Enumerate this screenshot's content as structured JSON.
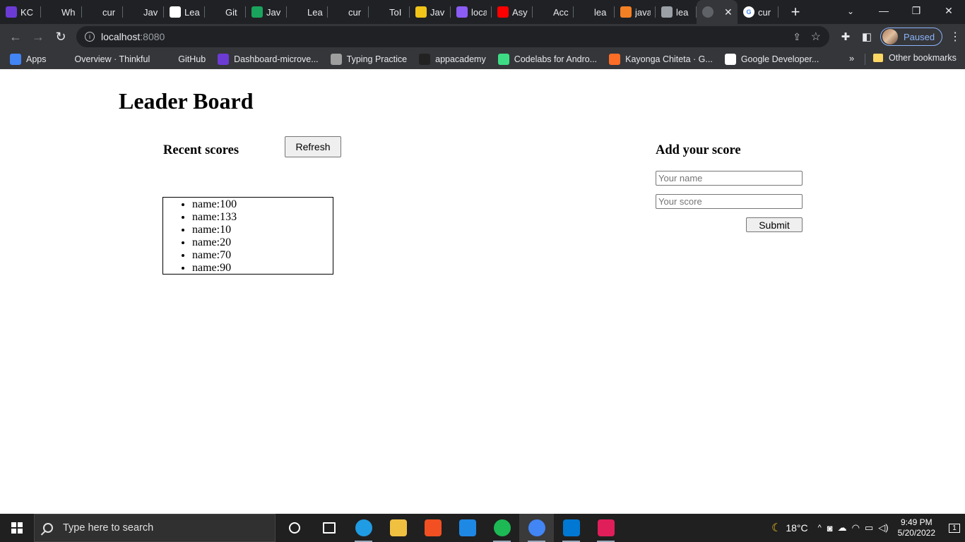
{
  "browser": {
    "tabs": [
      {
        "label": "KC",
        "icon": "microverse-icon",
        "color": "#6c3bd6"
      },
      {
        "label": "Wh",
        "icon": "astro-icon",
        "color": "#202124"
      },
      {
        "label": "cur",
        "icon": "github-icon",
        "color": "#202124"
      },
      {
        "label": "Jav",
        "icon": "astro-icon",
        "color": "#202124"
      },
      {
        "label": "Lea",
        "icon": "notion-icon",
        "color": "#ffffff"
      },
      {
        "label": "Git",
        "icon": "github-icon",
        "color": "#202124"
      },
      {
        "label": "Jav",
        "icon": "w-icon",
        "color": "#1aa35c"
      },
      {
        "label": "Lea",
        "icon": "refresh-github-icon",
        "color": "#202124"
      },
      {
        "label": "cur",
        "icon": "github-icon",
        "color": "#202124"
      },
      {
        "label": "ToI",
        "icon": "github-icon",
        "color": "#202124"
      },
      {
        "label": "Jav",
        "icon": "js-icon",
        "color": "#f0c419"
      },
      {
        "label": "loca",
        "icon": "rocket-icon",
        "color": "#8b5cf6"
      },
      {
        "label": "Asy",
        "icon": "youtube-icon",
        "color": "#ff0000"
      },
      {
        "label": "Acc",
        "icon": "thinkful-icon",
        "color": "#202124"
      },
      {
        "label": "lea",
        "icon": "github-icon",
        "color": "#202124"
      },
      {
        "label": "java",
        "icon": "stackoverflow-icon",
        "color": "#f48024"
      },
      {
        "label": "lea",
        "icon": "globe-icon",
        "color": "#9aa0a6"
      }
    ],
    "active_tab_close": "✕",
    "tab_after_active": {
      "label": "cur",
      "icon": "google-icon"
    },
    "new_tab": "+",
    "address": {
      "host": "localhost",
      "port": ":8080"
    },
    "profile_status": "Paused"
  },
  "bookmarks": [
    {
      "label": "Apps",
      "icon": "apps-grid-icon",
      "color": "#4285f4"
    },
    {
      "label": "Overview · Thinkful",
      "icon": "thinkful-icon",
      "color": "#35363a"
    },
    {
      "label": "GitHub",
      "icon": "github-icon",
      "color": "#35363a"
    },
    {
      "label": "Dashboard-microve...",
      "icon": "microverse-icon",
      "color": "#6c3bd6"
    },
    {
      "label": "Typing Practice",
      "icon": "typing-icon",
      "color": "#9e9e9e"
    },
    {
      "label": "appacademy",
      "icon": "appacademy-icon",
      "color": "#222222"
    },
    {
      "label": "Codelabs for Andro...",
      "icon": "android-icon",
      "color": "#3ddc84"
    },
    {
      "label": "Kayonga Chiteta · G...",
      "icon": "gitlab-icon",
      "color": "#fc6d26"
    },
    {
      "label": "Google Developer...",
      "icon": "google-dev-icon",
      "color": "#ffffff"
    }
  ],
  "bookmarks_more": "»",
  "other_bookmarks": "Other bookmarks",
  "page": {
    "title": "Leader Board",
    "recent_heading": "Recent scores",
    "refresh_label": "Refresh",
    "scores": [
      "name:100",
      "name:133",
      "name:10",
      "name:20",
      "name:70",
      "name:90"
    ],
    "add_heading": "Add your score",
    "name_placeholder": "Your name",
    "score_placeholder": "Your score",
    "submit_label": "Submit"
  },
  "taskbar": {
    "search_placeholder": "Type here to search",
    "apps": [
      {
        "name": "cortana",
        "color": "#202020"
      },
      {
        "name": "task-view",
        "color": "#202020"
      },
      {
        "name": "edge",
        "color": "#1f9ce3"
      },
      {
        "name": "file-explorer",
        "color": "#f0c040"
      },
      {
        "name": "store",
        "color": "#f25022"
      },
      {
        "name": "mail",
        "color": "#1e88e5"
      },
      {
        "name": "spotify",
        "color": "#1db954"
      },
      {
        "name": "chrome",
        "color": "#4285f4"
      },
      {
        "name": "vscode",
        "color": "#0078d4"
      },
      {
        "name": "slack",
        "color": "#e01e5a"
      }
    ],
    "temperature": "18°C",
    "time": "9:49 PM",
    "date": "5/20/2022",
    "notifications": "1"
  }
}
